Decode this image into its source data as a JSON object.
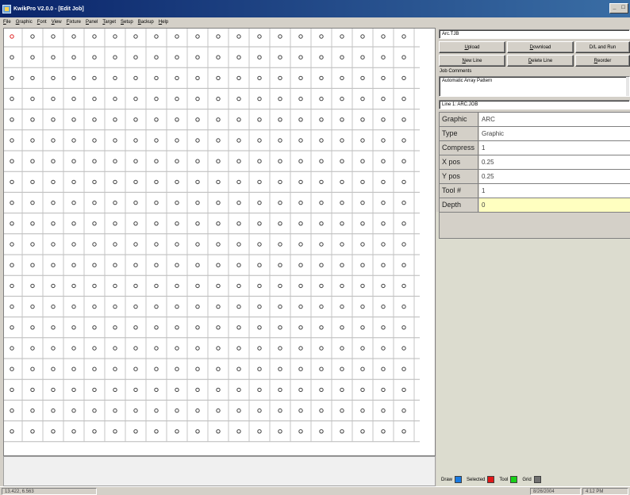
{
  "window": {
    "title": "KwikPro  V2.0.0 - [Edit Job]",
    "controls": [
      "_",
      "□"
    ]
  },
  "menu": [
    "File",
    "Graphic",
    "Font",
    "View",
    "Fixture",
    "Panel",
    "Target",
    "Setup",
    "Backup",
    "Help"
  ],
  "grid": {
    "rows": 20,
    "cols": 20,
    "selected": {
      "row": 0,
      "col": 0
    },
    "marker_color": "#404040",
    "selected_color": "#e02020"
  },
  "panel": {
    "file_field": "Arc.TJB",
    "buttons": {
      "upload": "Upload",
      "download": "Download",
      "dl_run": "D/L and Run",
      "new_line": "New Line",
      "delete_line": "Delete Line",
      "reorder": "Reorder"
    },
    "job_comments_label": "Job Comments",
    "job_comments": "Automatic Array Pattern",
    "line_select": "Line 1: ARC.JOB",
    "properties": [
      {
        "name": "Graphic",
        "value": "ARC"
      },
      {
        "name": "Type",
        "value": "Graphic"
      },
      {
        "name": "Compress",
        "value": "1"
      },
      {
        "name": "X pos",
        "value": "0.25"
      },
      {
        "name": "Y pos",
        "value": "0.25"
      },
      {
        "name": "Tool #",
        "value": "1"
      },
      {
        "name": "Depth",
        "value": "0"
      }
    ]
  },
  "legend": {
    "draw": "Draw",
    "draw_color": "#1a7ae0",
    "selected": "Selected",
    "selected_color": "#e01818",
    "tool": "Tool",
    "tool_color": "#18d018",
    "grid": "Grid",
    "grid_color": "#707070"
  },
  "status": {
    "coords": "13.422, 6.563",
    "date": "8/26/2004",
    "time": "4:12 PM"
  }
}
